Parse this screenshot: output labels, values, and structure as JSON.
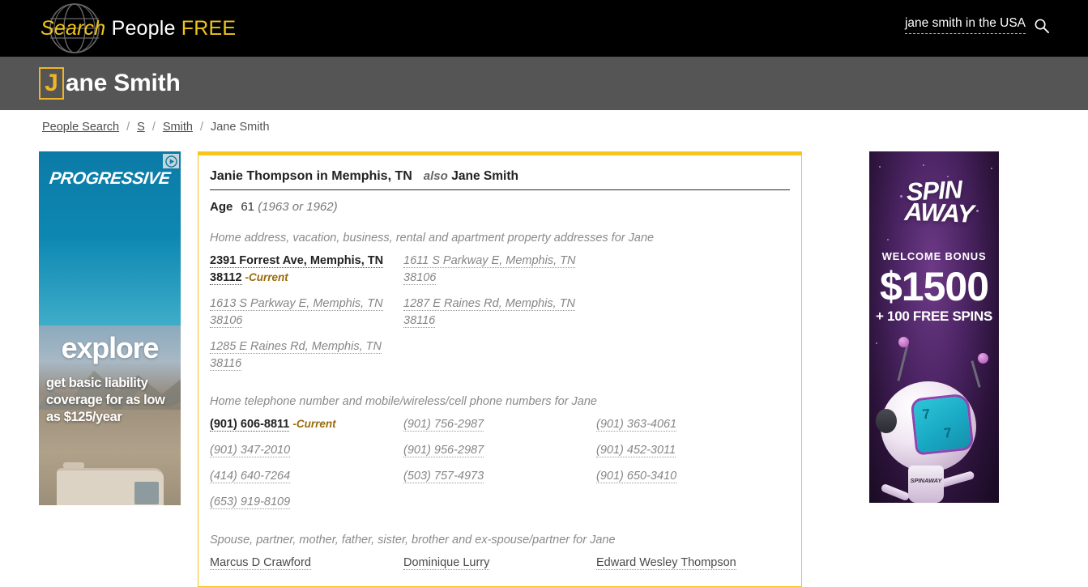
{
  "header": {
    "logo": {
      "word1": "Search",
      "word2": "People",
      "word3": "FREE",
      "globe_icon": "globe-icon"
    },
    "search": {
      "query": "jane smith in the USA",
      "icon": "search-icon"
    }
  },
  "name_bar": {
    "initial": "J",
    "rest": "ane Smith"
  },
  "breadcrumb": {
    "items": [
      {
        "label": "People Search",
        "link": true
      },
      {
        "label": "S",
        "link": true
      },
      {
        "label": "Smith",
        "link": true
      },
      {
        "label": "Jane Smith",
        "link": false
      }
    ],
    "separator": "/"
  },
  "record": {
    "title": "Janie Thompson in Memphis, TN",
    "also_label": "also",
    "alias": "Jane Smith",
    "age_label": "Age",
    "age_value": "61",
    "age_years": "(1963 or 1962)",
    "current_badge": "-Current",
    "addresses": {
      "caption": "Home address, vacation, business, rental and apartment property addresses for Jane",
      "items": [
        {
          "text": "2391 Forrest Ave, Memphis, TN 38112",
          "current": true
        },
        {
          "text": "1611 S Parkway E, Memphis, TN 38106",
          "current": false
        },
        {
          "text": "1613 S Parkway E, Memphis, TN 38106",
          "current": false
        },
        {
          "text": "1287 E Raines Rd, Memphis, TN 38116",
          "current": false
        },
        {
          "text": "1285 E Raines Rd, Memphis, TN 38116",
          "current": false
        }
      ]
    },
    "phones": {
      "caption": "Home telephone number and mobile/wireless/cell phone numbers for Jane",
      "items": [
        {
          "text": "(901) 606-8811",
          "current": true
        },
        {
          "text": "(901) 756-2987",
          "current": false
        },
        {
          "text": "(901) 363-4061",
          "current": false
        },
        {
          "text": "(901) 347-2010",
          "current": false
        },
        {
          "text": "(901) 956-2987",
          "current": false
        },
        {
          "text": "(901) 452-3011",
          "current": false
        },
        {
          "text": "(414) 640-7264",
          "current": false
        },
        {
          "text": "(503) 757-4973",
          "current": false
        },
        {
          "text": "(901) 650-3410",
          "current": false
        },
        {
          "text": "(653) 919-8109",
          "current": false
        }
      ]
    },
    "relatives": {
      "caption": "Spouse, partner, mother, father, sister, brother and ex-spouse/partner for Jane",
      "items": [
        {
          "text": "Marcus D Crawford"
        },
        {
          "text": "Dominique Lurry"
        },
        {
          "text": "Edward Wesley Thompson"
        }
      ]
    }
  },
  "ads": {
    "left": {
      "brand": "PROGRESSIVE",
      "headline": "explore",
      "tagline": "get basic liability coverage for as low as $125/year",
      "adchoices_icon": "adchoices-icon"
    },
    "right": {
      "logo_line1": "SPIN",
      "logo_line2": "AWAY",
      "trademark": "™",
      "welcome": "WELCOME BONUS",
      "amount": "$1500",
      "spins": "+ 100 FREE SPINS",
      "mascot_body_text": "SPINAWAY",
      "reel_symbol": "7"
    }
  },
  "colors": {
    "brand_gold": "#f0c419",
    "card_border": "#f5c31d",
    "current_badge": "#9a6b0c",
    "name_bar_bg": "#555555",
    "topbar_bg": "#000000"
  }
}
